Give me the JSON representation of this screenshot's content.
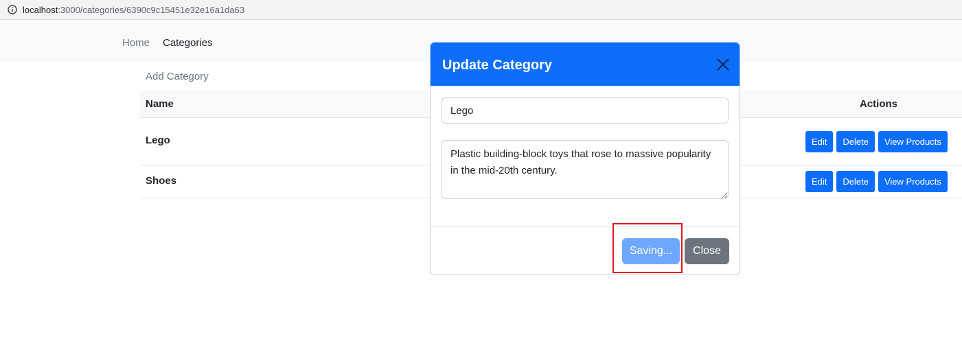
{
  "browser": {
    "url_host": "localhost",
    "url_path": ":3000/categories/6390c9c15451e32e16a1da63"
  },
  "nav": {
    "items": [
      {
        "label": "Home"
      },
      {
        "label": "Categories"
      }
    ]
  },
  "page": {
    "add_link": "Add Category",
    "table": {
      "headers": {
        "name": "Name",
        "actions": "Actions"
      },
      "rows": [
        {
          "name": "Lego"
        },
        {
          "name": "Shoes"
        }
      ],
      "action_labels": {
        "edit": "Edit",
        "delete": "Delete",
        "view": "View Products"
      }
    }
  },
  "modal": {
    "title": "Update Category",
    "name_value": "Lego",
    "description_value": "Plastic building-block toys that rose to massive popularity in the mid-20th century.",
    "saving_label": "Saving...",
    "close_label": "Close"
  },
  "colors": {
    "primary": "#0d6efd",
    "secondary": "#6c757d",
    "highlight": "#e0141e"
  }
}
